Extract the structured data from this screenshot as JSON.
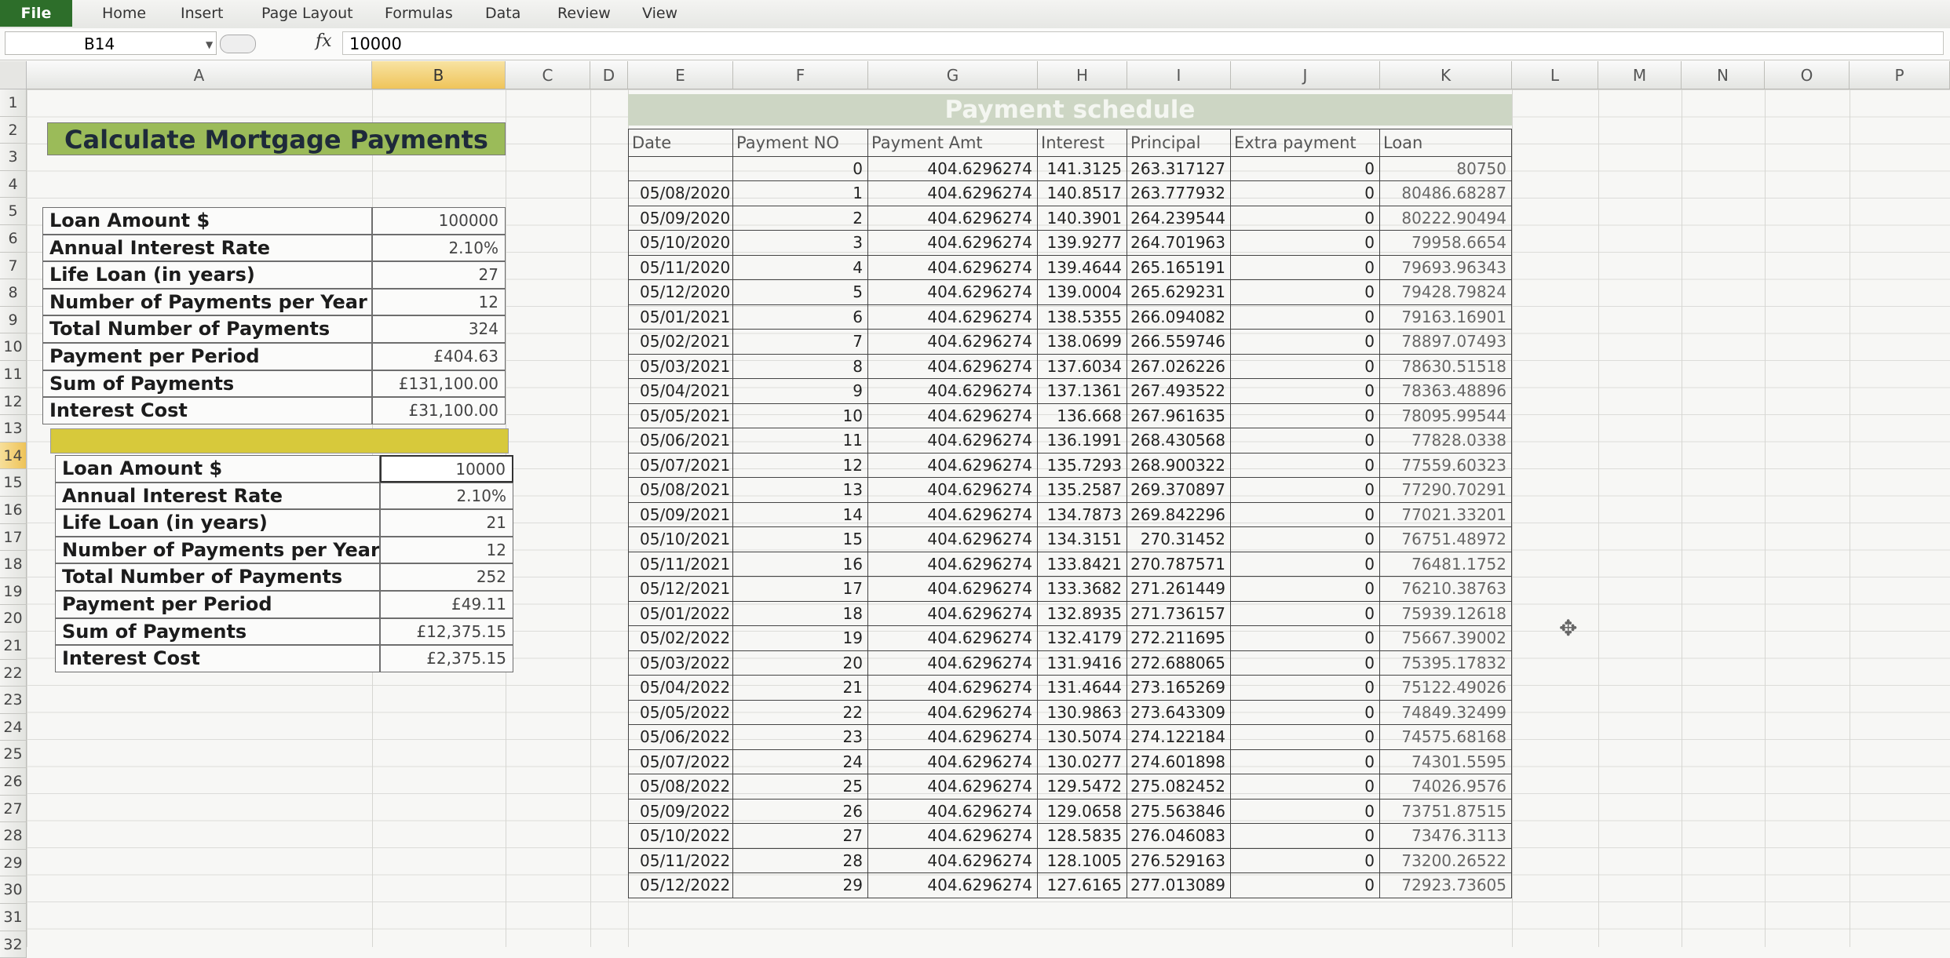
{
  "ribbon": {
    "tabs": [
      "File",
      "Home",
      "Insert",
      "Page Layout",
      "Formulas",
      "Data",
      "Review",
      "View"
    ]
  },
  "formula_bar": {
    "name_box": "B14",
    "fx": "fx",
    "value": "10000"
  },
  "columns": [
    "A",
    "B",
    "C",
    "D",
    "E",
    "F",
    "G",
    "H",
    "I",
    "J",
    "K",
    "L",
    "M",
    "N",
    "O",
    "P"
  ],
  "rows": [
    "1",
    "2",
    "3",
    "4",
    "5",
    "6",
    "7",
    "8",
    "9",
    "10",
    "11",
    "12",
    "13",
    "14",
    "15",
    "16",
    "17",
    "18",
    "19",
    "20",
    "21",
    "22",
    "23",
    "24",
    "25",
    "26",
    "27",
    "28",
    "29",
    "30",
    "31",
    "32"
  ],
  "calc": {
    "title": "Calculate Mortgage Payments",
    "block1": [
      {
        "label": "Loan Amount $",
        "value": "100000"
      },
      {
        "label": "Annual Interest Rate",
        "value": "2.10%"
      },
      {
        "label": "Life Loan (in years)",
        "value": "27"
      },
      {
        "label": "Number of Payments per Year",
        "value": "12"
      },
      {
        "label": "Total Number of Payments",
        "value": "324"
      },
      {
        "label": "Payment per Period",
        "value": "£404.63"
      },
      {
        "label": "Sum of Payments",
        "value": "£131,100.00"
      },
      {
        "label": "Interest Cost",
        "value": "£31,100.00"
      }
    ],
    "block2": [
      {
        "label": "Loan Amount $",
        "value": "10000"
      },
      {
        "label": "Annual Interest Rate",
        "value": "2.10%"
      },
      {
        "label": "Life Loan (in years)",
        "value": "21"
      },
      {
        "label": "Number of Payments per Year",
        "value": "12"
      },
      {
        "label": "Total Number of Payments",
        "value": "252"
      },
      {
        "label": "Payment per Period",
        "value": "£49.11"
      },
      {
        "label": "Sum of Payments",
        "value": "£12,375.15"
      },
      {
        "label": "Interest Cost",
        "value": "£2,375.15"
      }
    ]
  },
  "schedule": {
    "title": "Payment schedule",
    "headers": [
      "Date",
      "Payment NO",
      "Payment Amt",
      "Interest",
      "Principal",
      "Extra payment",
      "Loan"
    ],
    "rows": [
      [
        "",
        "0",
        "404.6296274",
        "141.3125",
        "263.317127",
        "0",
        "80750"
      ],
      [
        "05/08/2020",
        "1",
        "404.6296274",
        "140.8517",
        "263.777932",
        "0",
        "80486.68287"
      ],
      [
        "05/09/2020",
        "2",
        "404.6296274",
        "140.3901",
        "264.239544",
        "0",
        "80222.90494"
      ],
      [
        "05/10/2020",
        "3",
        "404.6296274",
        "139.9277",
        "264.701963",
        "0",
        "79958.6654"
      ],
      [
        "05/11/2020",
        "4",
        "404.6296274",
        "139.4644",
        "265.165191",
        "0",
        "79693.96343"
      ],
      [
        "05/12/2020",
        "5",
        "404.6296274",
        "139.0004",
        "265.629231",
        "0",
        "79428.79824"
      ],
      [
        "05/01/2021",
        "6",
        "404.6296274",
        "138.5355",
        "266.094082",
        "0",
        "79163.16901"
      ],
      [
        "05/02/2021",
        "7",
        "404.6296274",
        "138.0699",
        "266.559746",
        "0",
        "78897.07493"
      ],
      [
        "05/03/2021",
        "8",
        "404.6296274",
        "137.6034",
        "267.026226",
        "0",
        "78630.51518"
      ],
      [
        "05/04/2021",
        "9",
        "404.6296274",
        "137.1361",
        "267.493522",
        "0",
        "78363.48896"
      ],
      [
        "05/05/2021",
        "10",
        "404.6296274",
        "136.668",
        "267.961635",
        "0",
        "78095.99544"
      ],
      [
        "05/06/2021",
        "11",
        "404.6296274",
        "136.1991",
        "268.430568",
        "0",
        "77828.0338"
      ],
      [
        "05/07/2021",
        "12",
        "404.6296274",
        "135.7293",
        "268.900322",
        "0",
        "77559.60323"
      ],
      [
        "05/08/2021",
        "13",
        "404.6296274",
        "135.2587",
        "269.370897",
        "0",
        "77290.70291"
      ],
      [
        "05/09/2021",
        "14",
        "404.6296274",
        "134.7873",
        "269.842296",
        "0",
        "77021.33201"
      ],
      [
        "05/10/2021",
        "15",
        "404.6296274",
        "134.3151",
        "270.31452",
        "0",
        "76751.48972"
      ],
      [
        "05/11/2021",
        "16",
        "404.6296274",
        "133.8421",
        "270.787571",
        "0",
        "76481.1752"
      ],
      [
        "05/12/2021",
        "17",
        "404.6296274",
        "133.3682",
        "271.261449",
        "0",
        "76210.38763"
      ],
      [
        "05/01/2022",
        "18",
        "404.6296274",
        "132.8935",
        "271.736157",
        "0",
        "75939.12618"
      ],
      [
        "05/02/2022",
        "19",
        "404.6296274",
        "132.4179",
        "272.211695",
        "0",
        "75667.39002"
      ],
      [
        "05/03/2022",
        "20",
        "404.6296274",
        "131.9416",
        "272.688065",
        "0",
        "75395.17832"
      ],
      [
        "05/04/2022",
        "21",
        "404.6296274",
        "131.4644",
        "273.165269",
        "0",
        "75122.49026"
      ],
      [
        "05/05/2022",
        "22",
        "404.6296274",
        "130.9863",
        "273.643309",
        "0",
        "74849.32499"
      ],
      [
        "05/06/2022",
        "23",
        "404.6296274",
        "130.5074",
        "274.122184",
        "0",
        "74575.68168"
      ],
      [
        "05/07/2022",
        "24",
        "404.6296274",
        "130.0277",
        "274.601898",
        "0",
        "74301.5595"
      ],
      [
        "05/08/2022",
        "25",
        "404.6296274",
        "129.5472",
        "275.082452",
        "0",
        "74026.9576"
      ],
      [
        "05/09/2022",
        "26",
        "404.6296274",
        "129.0658",
        "275.563846",
        "0",
        "73751.87515"
      ],
      [
        "05/10/2022",
        "27",
        "404.6296274",
        "128.5835",
        "276.046083",
        "0",
        "73476.3113"
      ],
      [
        "05/11/2022",
        "28",
        "404.6296274",
        "128.1005",
        "276.529163",
        "0",
        "73200.26522"
      ],
      [
        "05/12/2022",
        "29",
        "404.6296274",
        "127.6165",
        "277.013089",
        "0",
        "72923.73605"
      ]
    ]
  }
}
